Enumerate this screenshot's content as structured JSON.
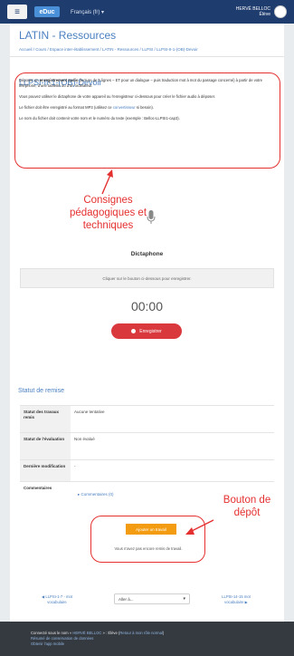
{
  "navbar": {
    "menu_icon": "hamburger-icon",
    "logo_text": "eDuc",
    "language": "Français (fr) ▾",
    "user_name": "HERVÉ BELLOC",
    "user_role": "Élève"
  },
  "course": {
    "title": "LATIN - Ressources",
    "breadcrumb": "Accueil / Cours / Espace inter-établissement / LATIN - Ressources / LLPSI / LLPSI-II-1-(OB)-Devoir"
  },
  "assignment": {
    "title": "LLPSI-II-1-(OB)-Devoir",
    "para1_pre": "Déposer un ",
    "para1_bold": "enregistrement audio",
    "para1_post": " (lecture de 5 lignes – ET pour un dialogue – puis traduction mot à mot du passage concerné) à partir de votre téléphone, d'une tablette ou d'un ordinateur.",
    "para2": "Vous pouvez utiliser le dictaphone de votre appareil ou l'enregistreur ci-dessous pour créer le fichier audio à déposer.",
    "para3_pre": "Le fichier doit être enregistré au format MP3 (utilisez ce ",
    "para3_link": "convertisseur",
    "para3_post": " si besoin).",
    "para4": "Le nom du fichier doit contenir votre nom et le numéro du texte (exemple : Belloc-LLPSI1-cap3)."
  },
  "annotations": {
    "consignes": "Consignes pédagogiques et techniques",
    "bouton": "Bouton de dépôt"
  },
  "dictaphone": {
    "mic_icon": "microphone-icon",
    "title": "Dictaphone",
    "hint": "Cliquer sur le bouton ci-dessous pour enregistrer.",
    "timer": "00:00",
    "record_label": "Enregistrer"
  },
  "status": {
    "title": "Statut de remise",
    "rows": [
      {
        "key": "Statut des travaux remis",
        "value": "Aucune tentative"
      },
      {
        "key": "Statut de l'évaluation",
        "value": "Non évalué"
      },
      {
        "key": "Dernière modification",
        "value": "-"
      },
      {
        "key": "Commentaires",
        "value": ""
      }
    ],
    "comments_toggle": "▸ Commentaires (0)"
  },
  "submission": {
    "button_label": "Ajouter un travail",
    "note": "Vous n'avez pas encore remis de travail."
  },
  "nav": {
    "prev": "◀ LLPSI-1-7 - mot vocabulaire",
    "jump_label": "Aller à...",
    "next": "LLPSI-14-15 mot vocabulaire ▶"
  },
  "footer": {
    "logged_pre": "Connecté sous le nom « ",
    "logged_user": "HERVÉ BELLOC",
    "logged_mid": " » : Élève (",
    "logged_link": "Retour à mon rôle normal",
    "logged_post": ")",
    "data_policy": "Résumé de conservation de données",
    "mobile": "Obtenir l'app mobile"
  },
  "colors": {
    "navbar": "#1f3c6e",
    "accent": "#4a7fc0",
    "annotation": "#e53030",
    "record": "#d9383d",
    "submit": "#f39c12"
  }
}
